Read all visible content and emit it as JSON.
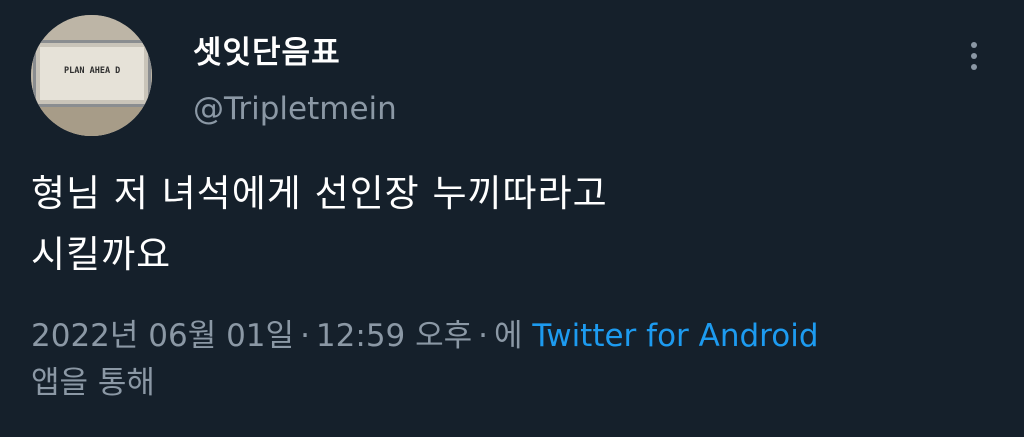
{
  "author": {
    "display_name": "셋잇단음표",
    "handle": "@Tripletmein",
    "avatar_text": "PLAN AHEA D"
  },
  "tweet": {
    "text_line1": "형님 저 녀석에게 선인장 누끼따라고",
    "text_line2": "시킬까요"
  },
  "meta": {
    "date": "2022년 06월 01일",
    "separator": "·",
    "time": "12:59 오후",
    "via_prefix": "에",
    "source": "Twitter for Android",
    "via_suffix": "앱을 통해"
  },
  "icons": {
    "more": "more-vertical-icon"
  },
  "colors": {
    "background": "#15202b",
    "text": "#ffffff",
    "secondary": "#8b98a5",
    "link": "#1d9bf0"
  }
}
